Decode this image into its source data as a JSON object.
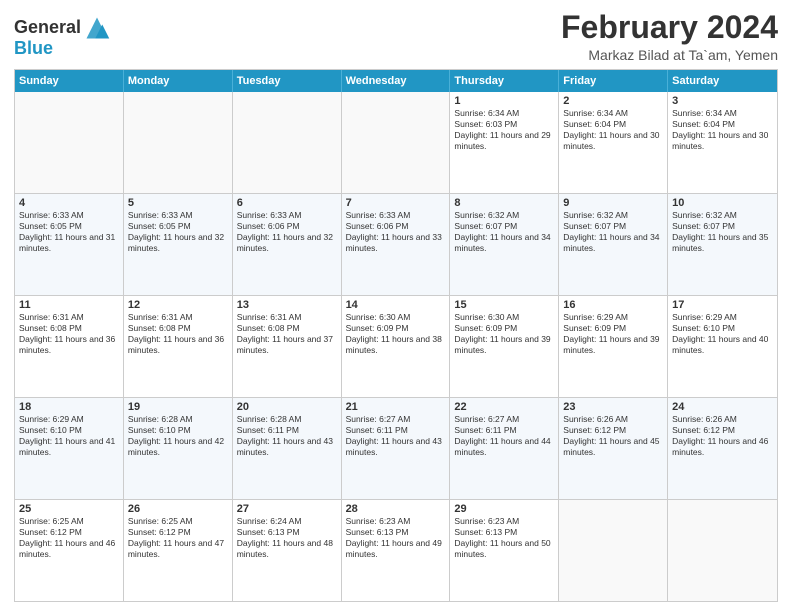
{
  "header": {
    "logo_line1": "General",
    "logo_line2": "Blue",
    "month": "February 2024",
    "location": "Markaz Bilad at Ta`am, Yemen"
  },
  "weekdays": [
    "Sunday",
    "Monday",
    "Tuesday",
    "Wednesday",
    "Thursday",
    "Friday",
    "Saturday"
  ],
  "weeks": [
    [
      {
        "day": "",
        "info": ""
      },
      {
        "day": "",
        "info": ""
      },
      {
        "day": "",
        "info": ""
      },
      {
        "day": "",
        "info": ""
      },
      {
        "day": "1",
        "info": "Sunrise: 6:34 AM\nSunset: 6:03 PM\nDaylight: 11 hours and 29 minutes."
      },
      {
        "day": "2",
        "info": "Sunrise: 6:34 AM\nSunset: 6:04 PM\nDaylight: 11 hours and 30 minutes."
      },
      {
        "day": "3",
        "info": "Sunrise: 6:34 AM\nSunset: 6:04 PM\nDaylight: 11 hours and 30 minutes."
      }
    ],
    [
      {
        "day": "4",
        "info": "Sunrise: 6:33 AM\nSunset: 6:05 PM\nDaylight: 11 hours and 31 minutes."
      },
      {
        "day": "5",
        "info": "Sunrise: 6:33 AM\nSunset: 6:05 PM\nDaylight: 11 hours and 32 minutes."
      },
      {
        "day": "6",
        "info": "Sunrise: 6:33 AM\nSunset: 6:06 PM\nDaylight: 11 hours and 32 minutes."
      },
      {
        "day": "7",
        "info": "Sunrise: 6:33 AM\nSunset: 6:06 PM\nDaylight: 11 hours and 33 minutes."
      },
      {
        "day": "8",
        "info": "Sunrise: 6:32 AM\nSunset: 6:07 PM\nDaylight: 11 hours and 34 minutes."
      },
      {
        "day": "9",
        "info": "Sunrise: 6:32 AM\nSunset: 6:07 PM\nDaylight: 11 hours and 34 minutes."
      },
      {
        "day": "10",
        "info": "Sunrise: 6:32 AM\nSunset: 6:07 PM\nDaylight: 11 hours and 35 minutes."
      }
    ],
    [
      {
        "day": "11",
        "info": "Sunrise: 6:31 AM\nSunset: 6:08 PM\nDaylight: 11 hours and 36 minutes."
      },
      {
        "day": "12",
        "info": "Sunrise: 6:31 AM\nSunset: 6:08 PM\nDaylight: 11 hours and 36 minutes."
      },
      {
        "day": "13",
        "info": "Sunrise: 6:31 AM\nSunset: 6:08 PM\nDaylight: 11 hours and 37 minutes."
      },
      {
        "day": "14",
        "info": "Sunrise: 6:30 AM\nSunset: 6:09 PM\nDaylight: 11 hours and 38 minutes."
      },
      {
        "day": "15",
        "info": "Sunrise: 6:30 AM\nSunset: 6:09 PM\nDaylight: 11 hours and 39 minutes."
      },
      {
        "day": "16",
        "info": "Sunrise: 6:29 AM\nSunset: 6:09 PM\nDaylight: 11 hours and 39 minutes."
      },
      {
        "day": "17",
        "info": "Sunrise: 6:29 AM\nSunset: 6:10 PM\nDaylight: 11 hours and 40 minutes."
      }
    ],
    [
      {
        "day": "18",
        "info": "Sunrise: 6:29 AM\nSunset: 6:10 PM\nDaylight: 11 hours and 41 minutes."
      },
      {
        "day": "19",
        "info": "Sunrise: 6:28 AM\nSunset: 6:10 PM\nDaylight: 11 hours and 42 minutes."
      },
      {
        "day": "20",
        "info": "Sunrise: 6:28 AM\nSunset: 6:11 PM\nDaylight: 11 hours and 43 minutes."
      },
      {
        "day": "21",
        "info": "Sunrise: 6:27 AM\nSunset: 6:11 PM\nDaylight: 11 hours and 43 minutes."
      },
      {
        "day": "22",
        "info": "Sunrise: 6:27 AM\nSunset: 6:11 PM\nDaylight: 11 hours and 44 minutes."
      },
      {
        "day": "23",
        "info": "Sunrise: 6:26 AM\nSunset: 6:12 PM\nDaylight: 11 hours and 45 minutes."
      },
      {
        "day": "24",
        "info": "Sunrise: 6:26 AM\nSunset: 6:12 PM\nDaylight: 11 hours and 46 minutes."
      }
    ],
    [
      {
        "day": "25",
        "info": "Sunrise: 6:25 AM\nSunset: 6:12 PM\nDaylight: 11 hours and 46 minutes."
      },
      {
        "day": "26",
        "info": "Sunrise: 6:25 AM\nSunset: 6:12 PM\nDaylight: 11 hours and 47 minutes."
      },
      {
        "day": "27",
        "info": "Sunrise: 6:24 AM\nSunset: 6:13 PM\nDaylight: 11 hours and 48 minutes."
      },
      {
        "day": "28",
        "info": "Sunrise: 6:23 AM\nSunset: 6:13 PM\nDaylight: 11 hours and 49 minutes."
      },
      {
        "day": "29",
        "info": "Sunrise: 6:23 AM\nSunset: 6:13 PM\nDaylight: 11 hours and 50 minutes."
      },
      {
        "day": "",
        "info": ""
      },
      {
        "day": "",
        "info": ""
      }
    ]
  ]
}
